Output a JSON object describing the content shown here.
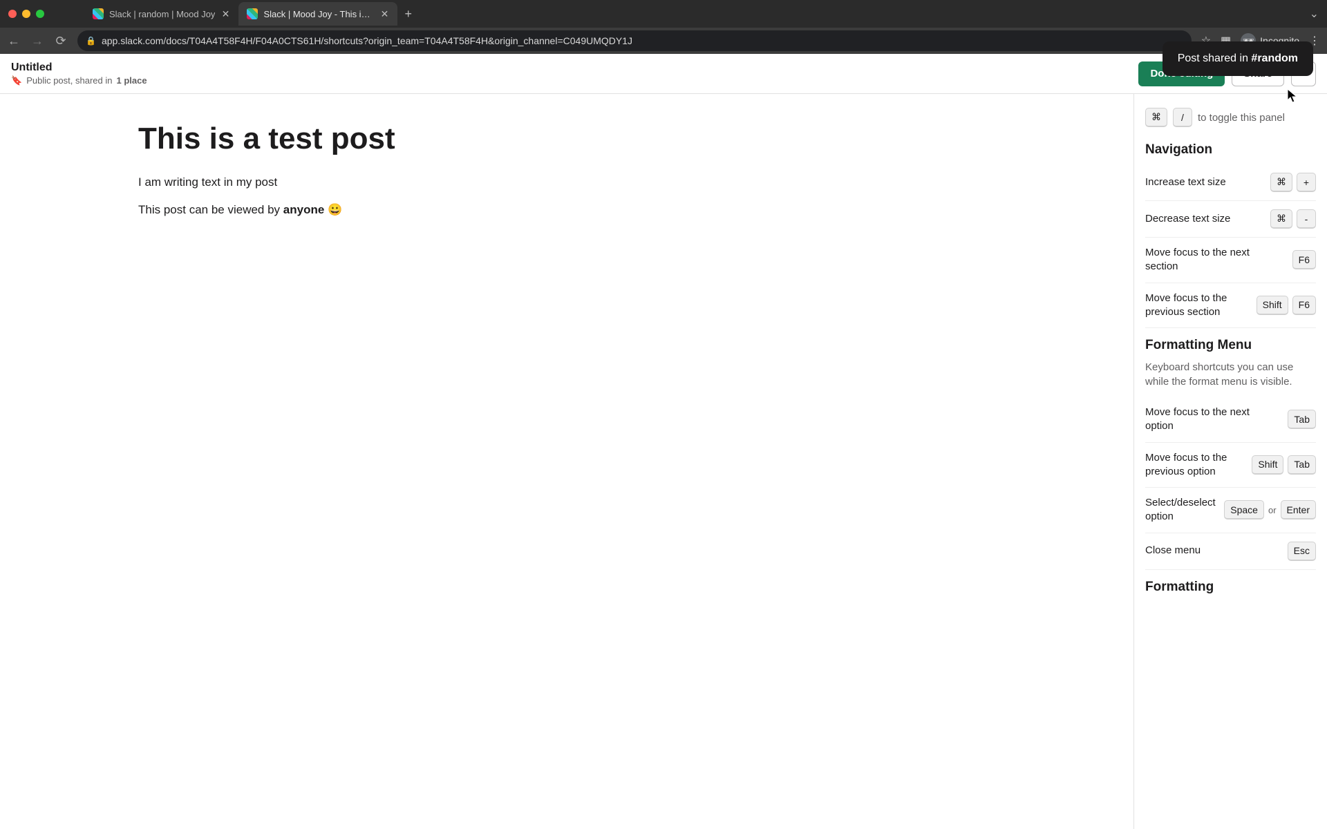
{
  "browser": {
    "tabs": [
      {
        "title": "Slack | random | Mood Joy"
      },
      {
        "title": "Slack | Mood Joy - This is a te"
      }
    ],
    "url": "app.slack.com/docs/T04A4T58F4H/F04A0CTS61H/shortcuts?origin_team=T04A4T58F4H&origin_channel=C049UMQDY1J",
    "incognito": "Incognito"
  },
  "header": {
    "doc_title": "Untitled",
    "doc_sub_prefix": "Public post, shared in ",
    "doc_sub_bold": "1 place",
    "done": "Done editing",
    "share": "Share"
  },
  "toast": {
    "prefix": "Post shared in ",
    "channel": "#random"
  },
  "post": {
    "title": "This is a test post",
    "line1": "I am writing text in my post",
    "line2_a": "This post can be viewed by ",
    "line2_b": "anyone",
    "line2_c": " 😀"
  },
  "panel": {
    "toggle_keys": [
      "⌘",
      "/"
    ],
    "toggle_text": "to toggle this panel",
    "nav_heading": "Navigation",
    "nav": [
      {
        "label": "Increase text size",
        "keys": [
          "⌘",
          "+"
        ]
      },
      {
        "label": "Decrease text size",
        "keys": [
          "⌘",
          "-"
        ]
      },
      {
        "label": "Move focus to the next section",
        "keys": [
          "F6"
        ]
      },
      {
        "label": "Move focus to the previous section",
        "keys": [
          "Shift",
          "F6"
        ]
      }
    ],
    "fmt_heading": "Formatting Menu",
    "fmt_desc": "Keyboard shortcuts you can use while the format menu is visible.",
    "fmt": [
      {
        "label": "Move focus to the next option",
        "keys": [
          "Tab"
        ]
      },
      {
        "label": "Move focus to the previous option",
        "keys": [
          "Shift",
          "Tab"
        ]
      },
      {
        "label": "Select/deselect option",
        "keys": [
          "Space",
          "or",
          "Enter"
        ]
      },
      {
        "label": "Close menu",
        "keys": [
          "Esc"
        ]
      }
    ],
    "fmt2_heading": "Formatting"
  }
}
